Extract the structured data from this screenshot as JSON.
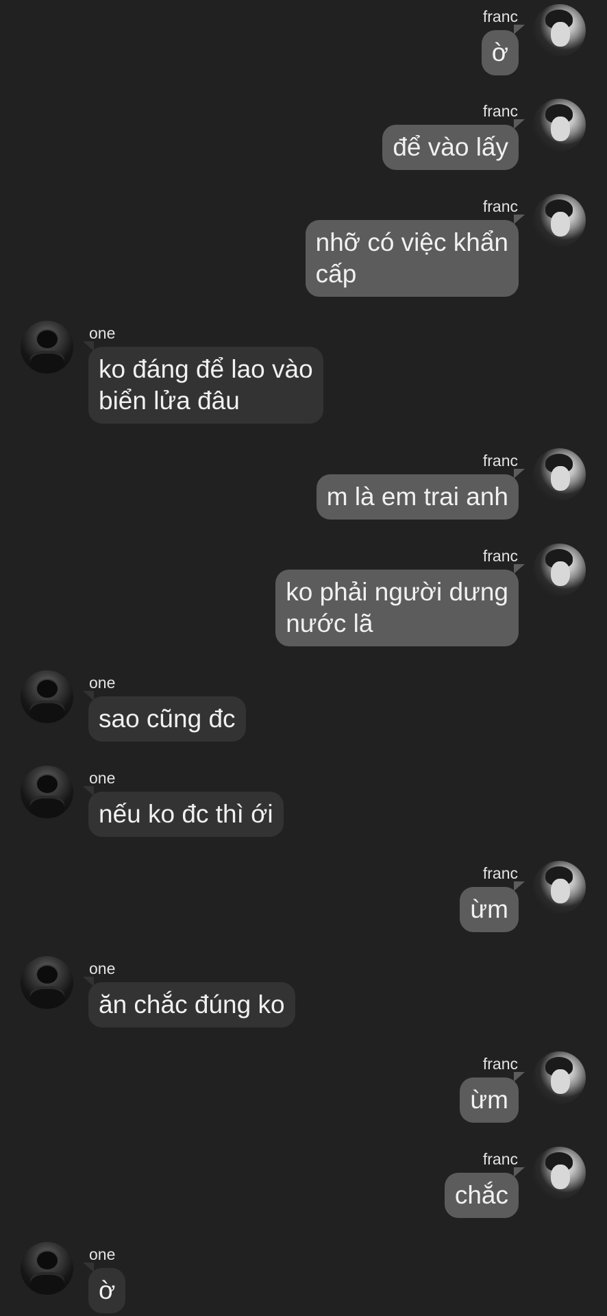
{
  "chat": {
    "messages": [
      {
        "sender": "franc",
        "side": "right",
        "lines": [
          "ờ"
        ]
      },
      {
        "sender": "franc",
        "side": "right",
        "lines": [
          "để vào lấy"
        ]
      },
      {
        "sender": "franc",
        "side": "right",
        "lines": [
          "nhỡ có việc khẩn",
          "cấp"
        ]
      },
      {
        "sender": "one",
        "side": "left",
        "lines": [
          "ko đáng để lao vào",
          "biển lửa đâu"
        ]
      },
      {
        "sender": "franc",
        "side": "right",
        "lines": [
          "m là em trai anh"
        ]
      },
      {
        "sender": "franc",
        "side": "right",
        "lines": [
          "ko phải người dưng",
          "nước lã"
        ]
      },
      {
        "sender": "one",
        "side": "left",
        "lines": [
          "sao cũng đc"
        ]
      },
      {
        "sender": "one",
        "side": "left",
        "lines": [
          "nếu ko đc thì ới"
        ]
      },
      {
        "sender": "franc",
        "side": "right",
        "lines": [
          "ừm"
        ]
      },
      {
        "sender": "one",
        "side": "left",
        "lines": [
          "ăn chắc đúng ko"
        ]
      },
      {
        "sender": "franc",
        "side": "right",
        "lines": [
          "ừm"
        ]
      },
      {
        "sender": "franc",
        "side": "right",
        "lines": [
          "chắc"
        ]
      },
      {
        "sender": "one",
        "side": "left",
        "lines": [
          "ờ"
        ]
      }
    ]
  },
  "colors": {
    "background": "#212121",
    "outgoing_bubble": "#5c5c5c",
    "incoming_bubble": "#333333",
    "text": "#f1f1f1"
  }
}
